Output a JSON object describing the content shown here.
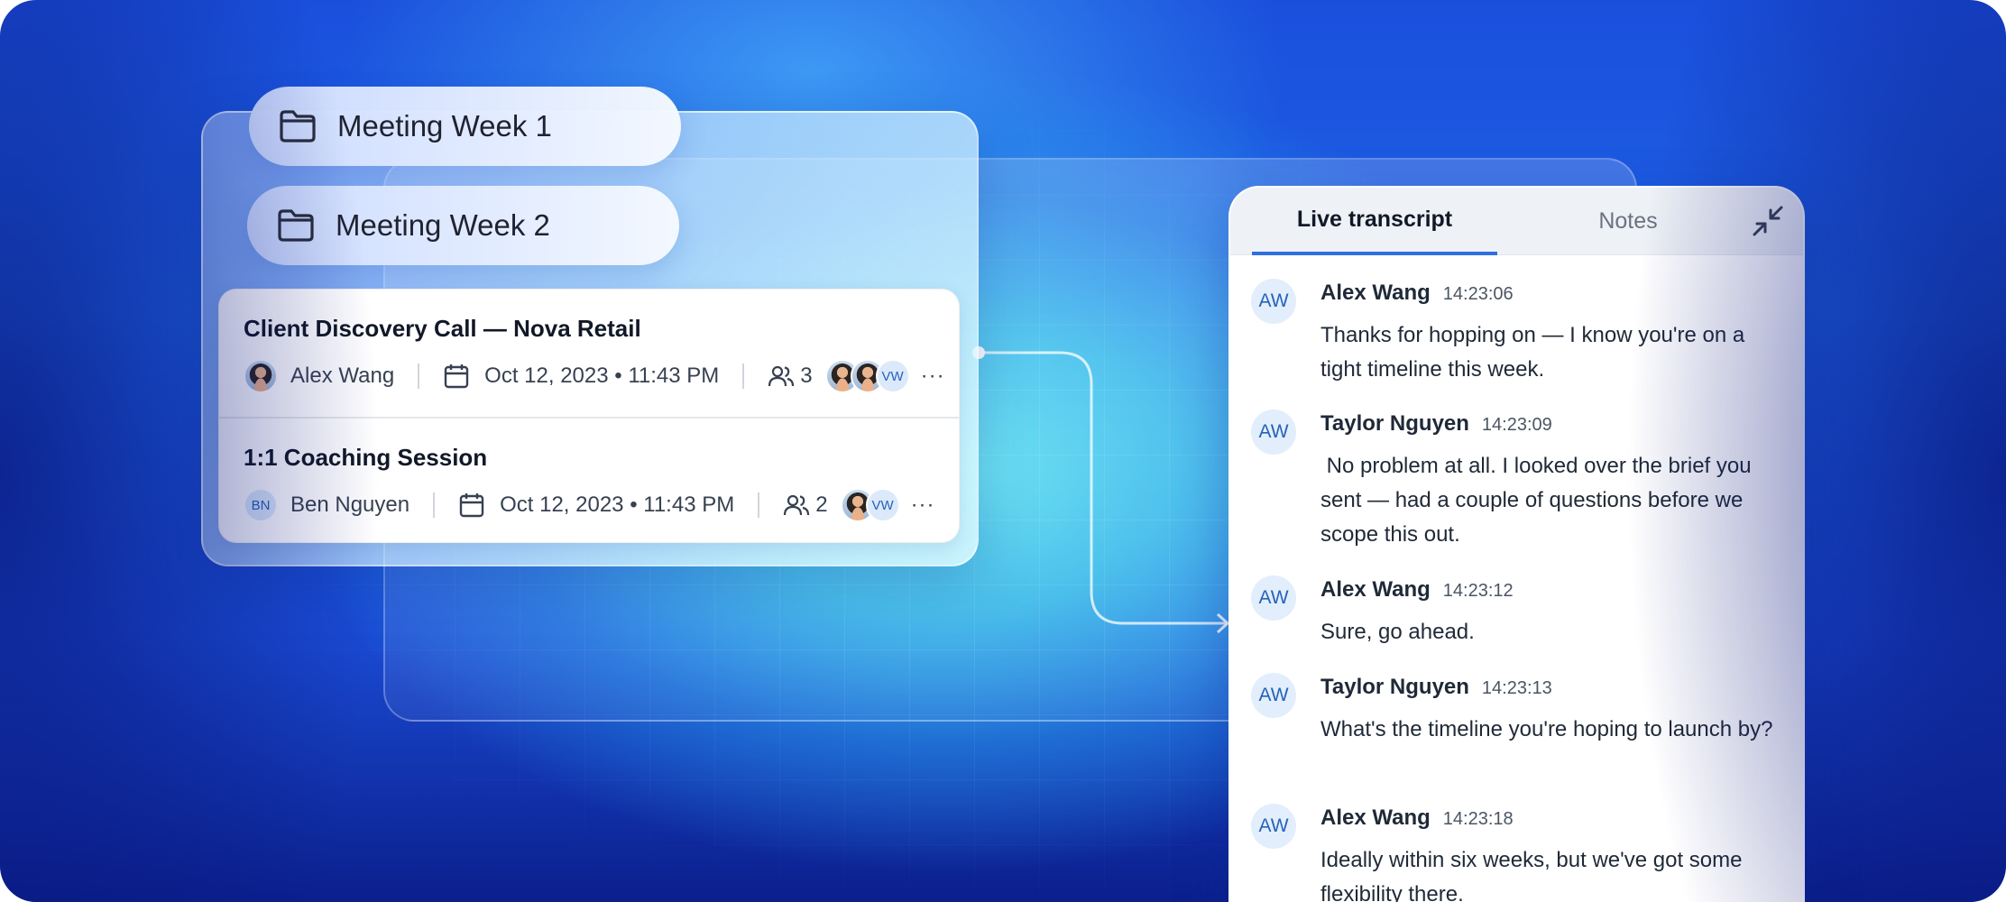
{
  "folders": [
    {
      "label": "Meeting Week 1",
      "icon": "folder-icon"
    },
    {
      "label": "Meeting Week 2",
      "icon": "folder-icon"
    }
  ],
  "meetings": [
    {
      "title": "Client Discovery Call — Nova Retail",
      "owner": "Alex Wang",
      "datetime": "Oct 12, 2023 • 11:43 PM",
      "participants_count": "3",
      "extra_avatar_initials": "VW",
      "more": "···"
    },
    {
      "title": "1:1 Coaching Session",
      "owner": "Ben Nguyen",
      "owner_initials": "BN",
      "datetime": "Oct 12, 2023 • 11:43 PM",
      "participants_count": "2",
      "extra_avatar_initials": "VW",
      "more": "···"
    }
  ],
  "transcript": {
    "tabs": {
      "active": "Live transcript",
      "inactive": "Notes"
    },
    "entries": [
      {
        "initials": "AW",
        "speaker": "Alex Wang",
        "time": "14:23:06",
        "text": "Thanks for hopping on — I know you're on a tight timeline this week."
      },
      {
        "initials": "AW",
        "speaker": "Taylor Nguyen",
        "time": "14:23:09",
        "text": " No problem at all. I looked over the brief you sent — had a couple of questions before we scope this out."
      },
      {
        "initials": "AW",
        "speaker": "Alex Wang",
        "time": "14:23:12",
        "text": "Sure, go ahead."
      },
      {
        "initials": "AW",
        "speaker": "Taylor Nguyen",
        "time": "14:23:13",
        "text": "What's the timeline you're hoping to launch by?"
      },
      {
        "initials": "AW",
        "speaker": "Alex Wang",
        "time": "14:23:18",
        "text": "Ideally within six weeks, but we've got some flexibility there."
      }
    ]
  },
  "colors": {
    "accent": "#2f6fe0",
    "avatar_bg": "#e2eefc",
    "avatar_text": "#2563b8"
  }
}
